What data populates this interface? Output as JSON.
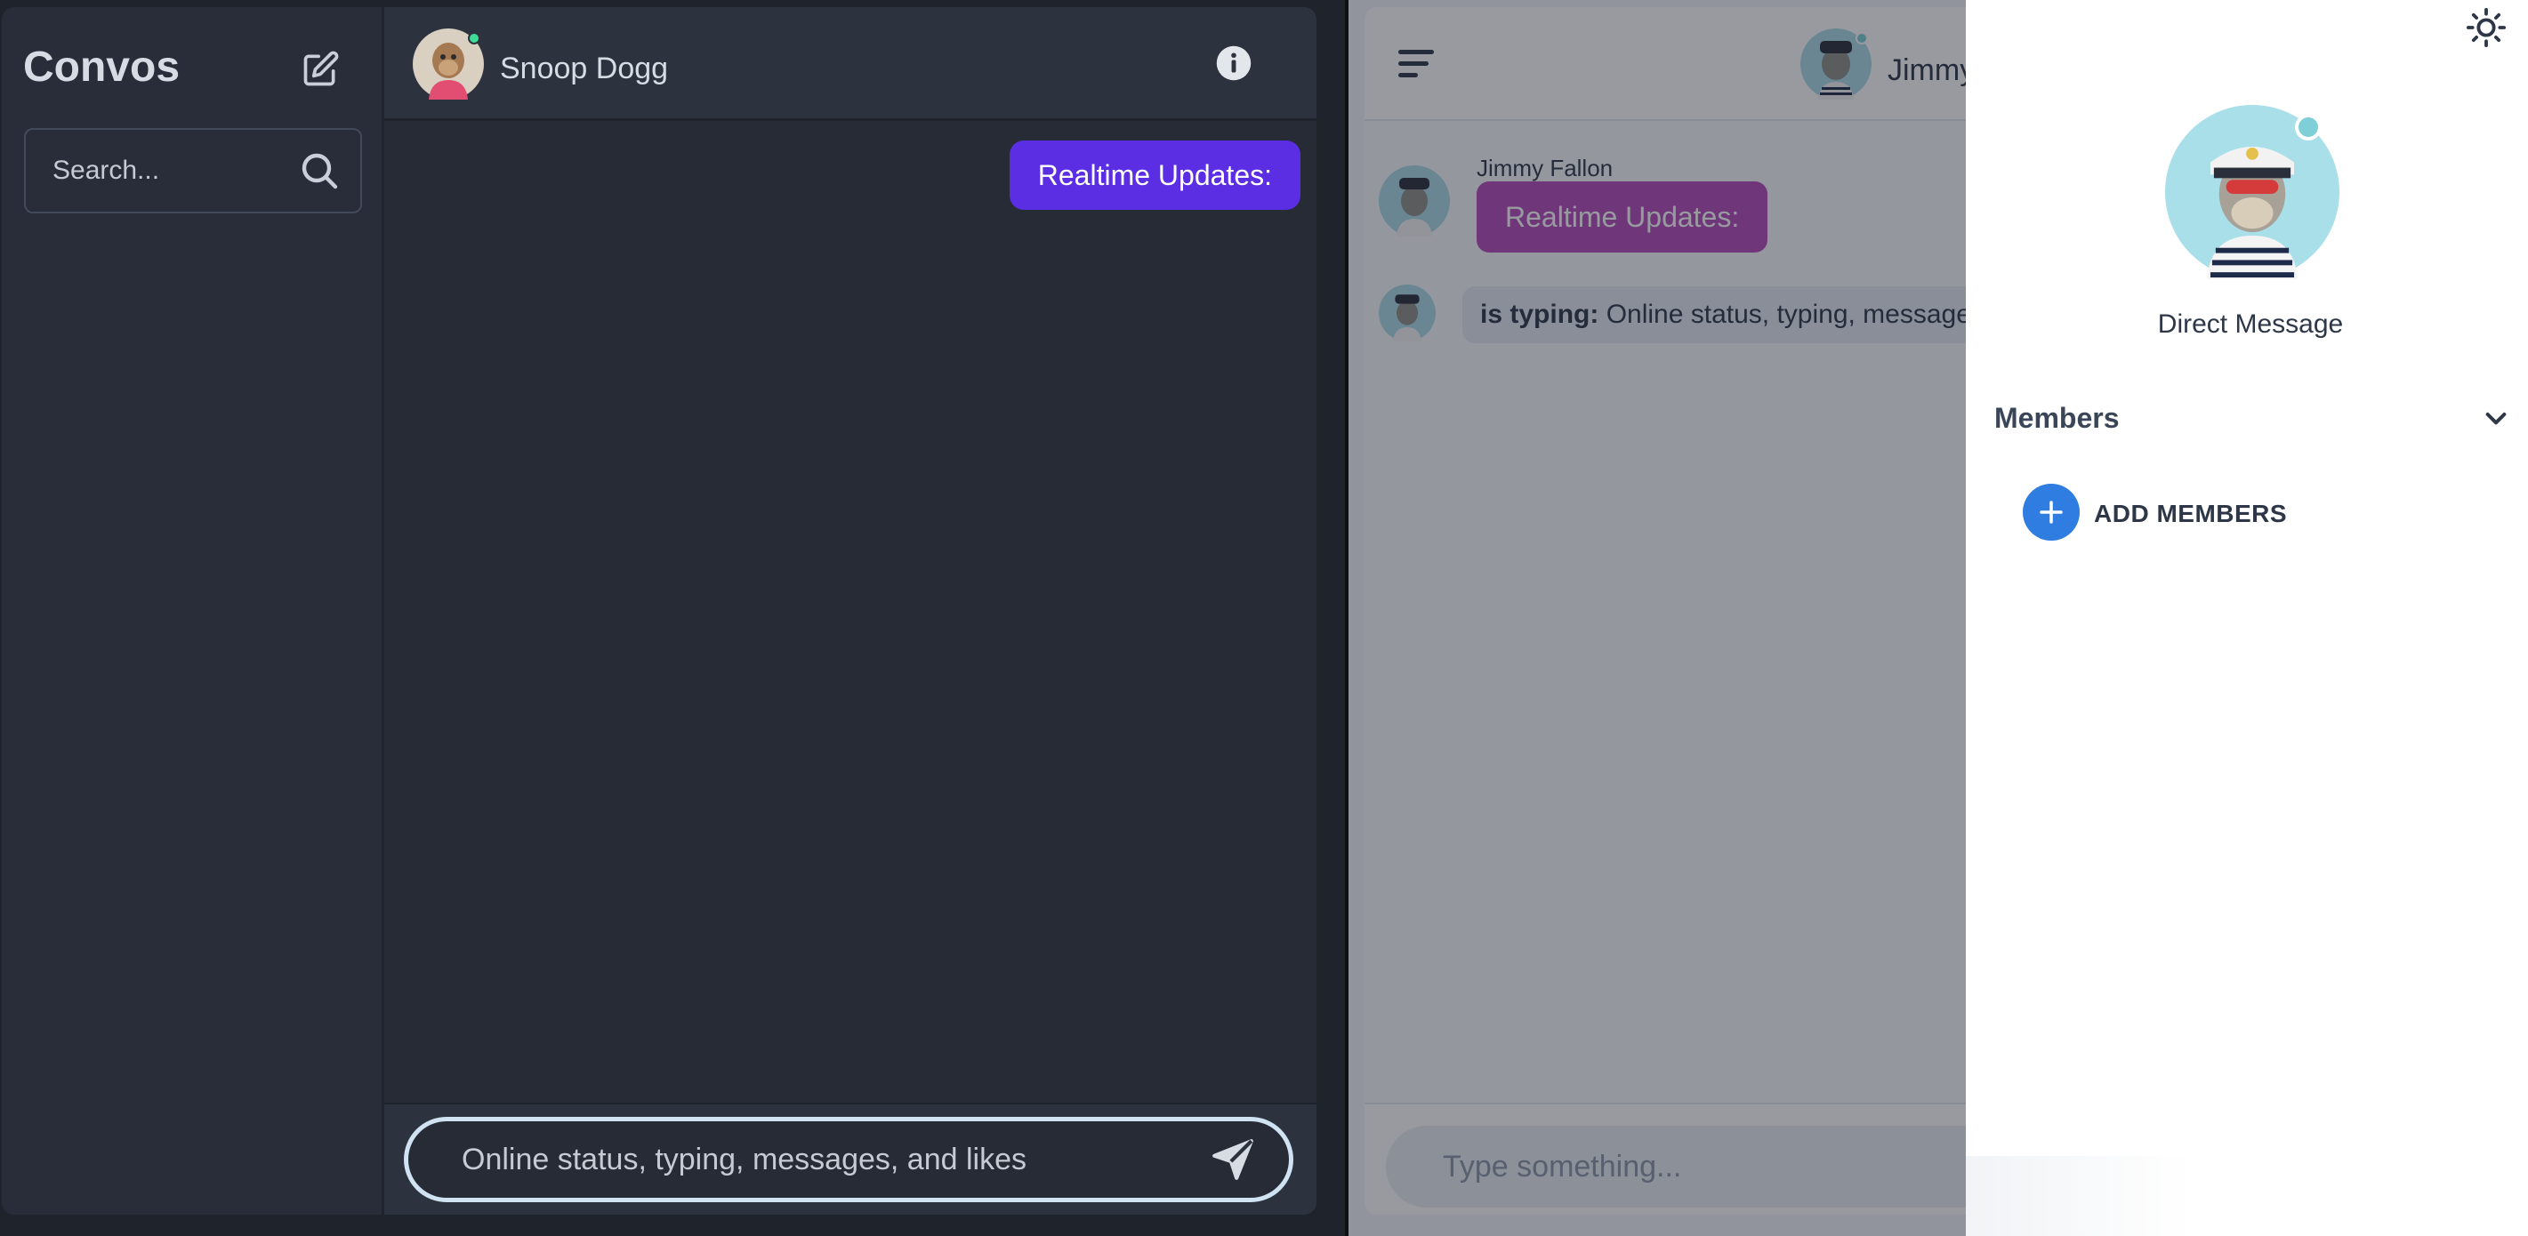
{
  "left_app": {
    "sidebar": {
      "title": "Convos",
      "search": {
        "placeholder": "Search...",
        "value": ""
      }
    },
    "chat": {
      "contact_name": "Snoop Dogg",
      "messages": [
        {
          "text": "Realtime Updates:",
          "direction": "sent"
        }
      ],
      "composer": {
        "value": "Online status, typing, messages, and likes",
        "placeholder": ""
      }
    },
    "colors": {
      "background": "#1f232c",
      "sent_bubble": "#5b2de3",
      "online": "#3ddc97"
    }
  },
  "right_app": {
    "chat": {
      "contact_name": "Jimmy",
      "message": {
        "sender": "Jimmy Fallon",
        "text": "Realtime Updates:"
      },
      "typing": {
        "label": "is typing:",
        "text": "Online status, typing, messages, a"
      },
      "composer": {
        "placeholder": "Type something..."
      }
    },
    "drawer": {
      "title": "Direct Message",
      "members_label": "Members",
      "add_members_label": "ADD MEMBERS"
    },
    "colors": {
      "received_bubble": "#b54bb9",
      "accent": "#2f7de1"
    }
  },
  "icons": [
    "compose-icon",
    "search-icon",
    "info-icon",
    "send-icon",
    "hamburger-icon",
    "sun-icon",
    "chevron-down-icon",
    "plus-icon"
  ]
}
